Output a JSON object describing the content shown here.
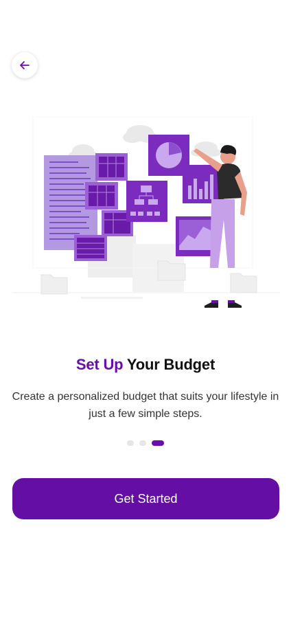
{
  "header": {
    "back_icon": "arrow-left-icon"
  },
  "colors": {
    "accent": "#6a0dad",
    "button": "#650ea6"
  },
  "onboarding": {
    "title_accent": "Set Up",
    "title_rest": " Your Budget",
    "subtitle": "Create a personalized budget that suits your lifestyle in just a few simple steps.",
    "pager": {
      "count": 3,
      "active_index": 2
    },
    "cta_label": "Get Started"
  }
}
